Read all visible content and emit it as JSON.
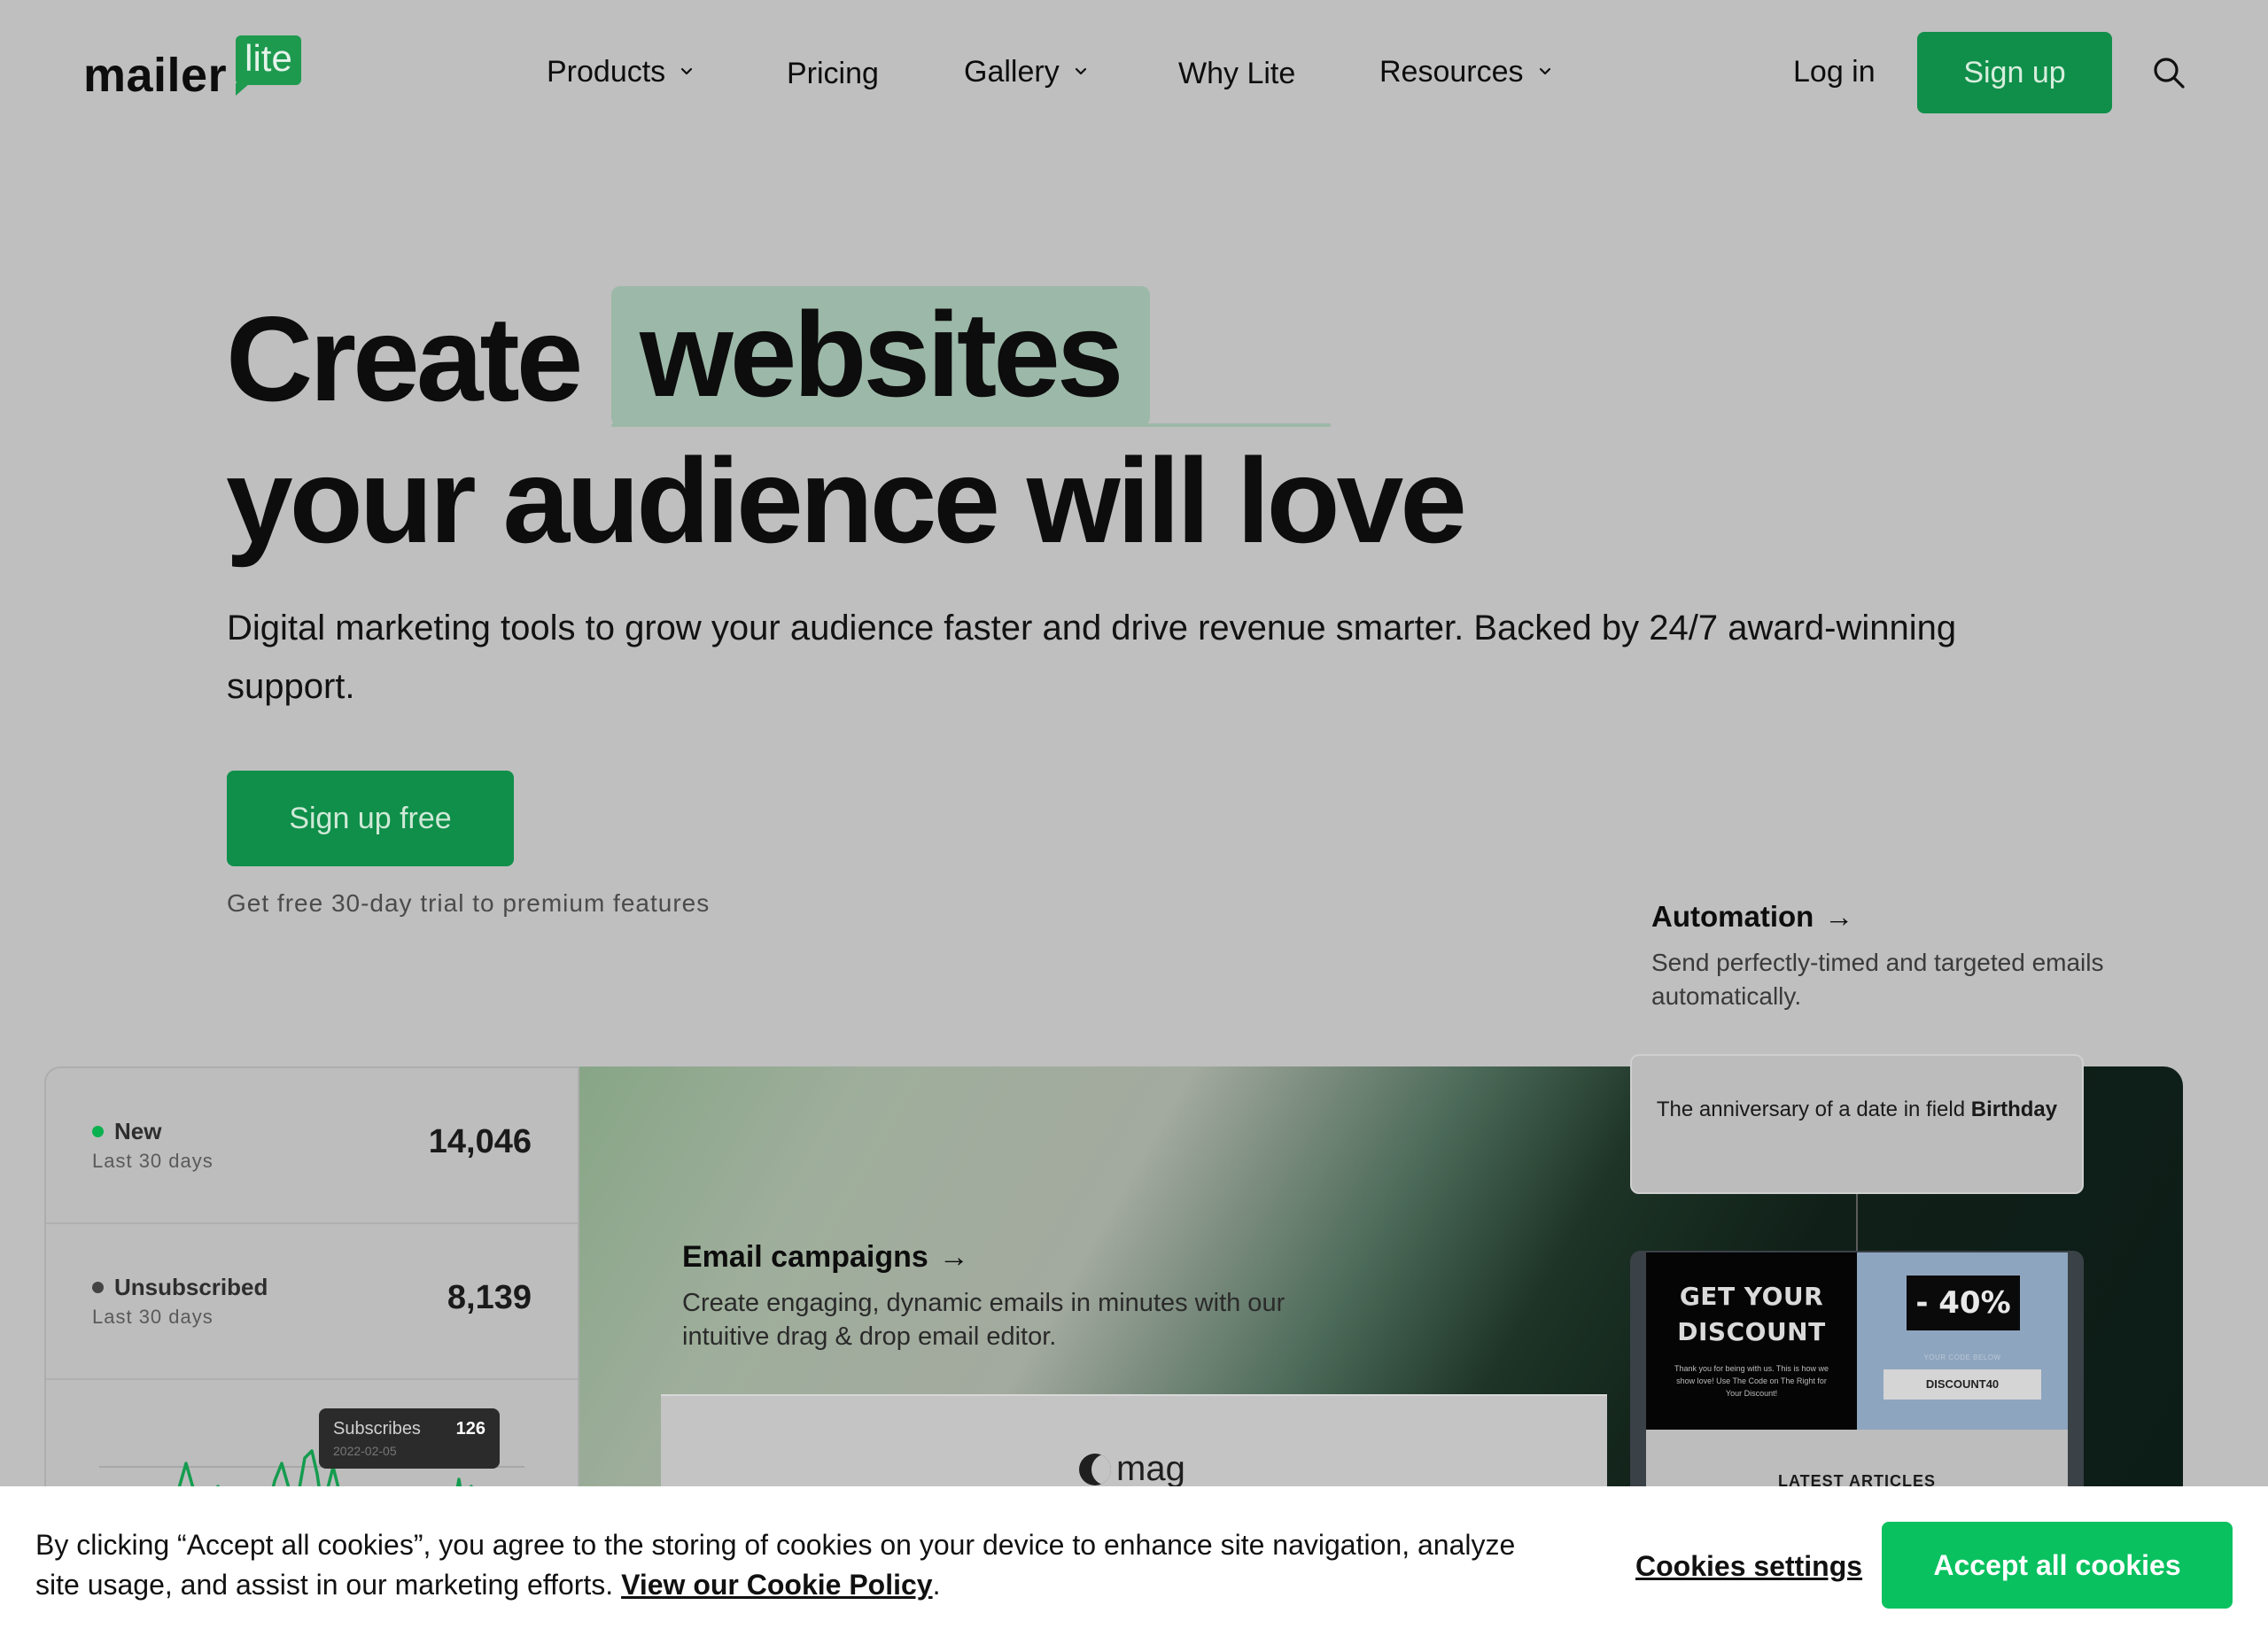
{
  "brand": {
    "word": "mailer",
    "badge": "lite",
    "accent": "#09c15f"
  },
  "nav": {
    "items": [
      {
        "label": "Products",
        "dropdown": true
      },
      {
        "label": "Pricing",
        "dropdown": false
      },
      {
        "label": "Gallery",
        "dropdown": true
      },
      {
        "label": "Why Lite",
        "dropdown": false
      },
      {
        "label": "Resources",
        "dropdown": true
      }
    ],
    "login": "Log in",
    "signup": "Sign up",
    "search_icon": "search-icon"
  },
  "hero": {
    "word1": "Create",
    "highlight": "websites",
    "line2": "your audience will love",
    "subtitle": "Digital marketing tools to grow your audience faster and drive revenue smarter. Backed by 24/7 award-winning support.",
    "cta": "Sign up free",
    "trial": "Get free 30-day trial to premium features"
  },
  "automation": {
    "title": "Automation",
    "arrow": "→",
    "desc": "Send perfectly-timed and targeted emails automatically."
  },
  "stats": {
    "rows": [
      {
        "label": "New",
        "sub": "Last 30 days",
        "value": "14,046",
        "dot_color": "#0bb14f"
      },
      {
        "label": "Unsubscribed",
        "sub": "Last 30 days",
        "value": "8,139",
        "dot_color": "#444444"
      }
    ],
    "tooltip": {
      "label": "Subscribes",
      "value": "126",
      "date": "2022-02-05"
    }
  },
  "email_campaigns": {
    "title": "Email campaigns",
    "arrow": "→",
    "desc": "Create engaging, dynamic emails in minutes with our intuitive drag & drop email editor.",
    "logo_text": "mag"
  },
  "trigger": {
    "text": "The anniversary of a date in field",
    "field": "Birthday"
  },
  "promo": {
    "headline_1": "GET YOUR",
    "headline_2": "DISCOUNT",
    "small": "Thank you for being with us. This is how we show love! Use The Code on The Right for Your Discount!",
    "percent": "- 40%",
    "code_label": "YOUR CODE BELOW",
    "code": "DISCOUNT40",
    "latest": "LATEST ARTICLES"
  },
  "cookie": {
    "text": "By clicking “Accept all cookies”, you agree to the storing of cookies on your device to enhance site navigation, analyze site usage, and assist in our marketing efforts.",
    "link": "View our Cookie Policy",
    "period": ".",
    "settings": "Cookies settings",
    "accept": "Accept all cookies"
  }
}
